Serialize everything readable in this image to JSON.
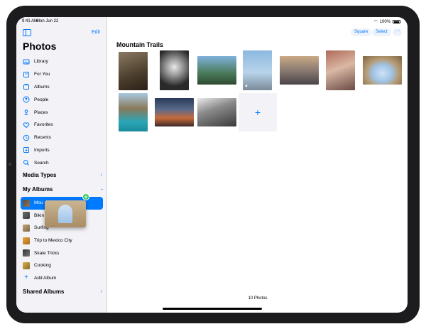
{
  "status_bar": {
    "time": "9:41 AM",
    "date": "Mon Jun 22",
    "battery": "100%"
  },
  "sidebar": {
    "edit_label": "Edit",
    "title": "Photos",
    "items": [
      {
        "label": "Library",
        "icon": "library-icon"
      },
      {
        "label": "For You",
        "icon": "for-you-icon"
      },
      {
        "label": "Albums",
        "icon": "albums-icon"
      },
      {
        "label": "People",
        "icon": "people-icon"
      },
      {
        "label": "Places",
        "icon": "places-icon"
      },
      {
        "label": "Favorites",
        "icon": "heart-icon"
      },
      {
        "label": "Recents",
        "icon": "clock-icon"
      },
      {
        "label": "Imports",
        "icon": "import-icon"
      },
      {
        "label": "Search",
        "icon": "search-icon"
      }
    ],
    "media_types_label": "Media Types",
    "my_albums_label": "My Albums",
    "albums": [
      {
        "label": "Mou",
        "selected": true
      },
      {
        "label": "Bikin",
        "selected": false
      },
      {
        "label": "Surfing",
        "selected": false
      },
      {
        "label": "Trip to Mexico City",
        "selected": false
      },
      {
        "label": "Skate Tricks",
        "selected": false
      },
      {
        "label": "Cooking",
        "selected": false
      }
    ],
    "add_album_label": "Add Album",
    "shared_albums_label": "Shared Albums"
  },
  "drag": {
    "badge": "+"
  },
  "toolbar": {
    "square_label": "Square",
    "select_label": "Select",
    "more_label": "···"
  },
  "main": {
    "album_title": "Mountain Trails",
    "add_symbol": "+",
    "photo_count": "10 Photos"
  },
  "accent_color": "#007aff"
}
